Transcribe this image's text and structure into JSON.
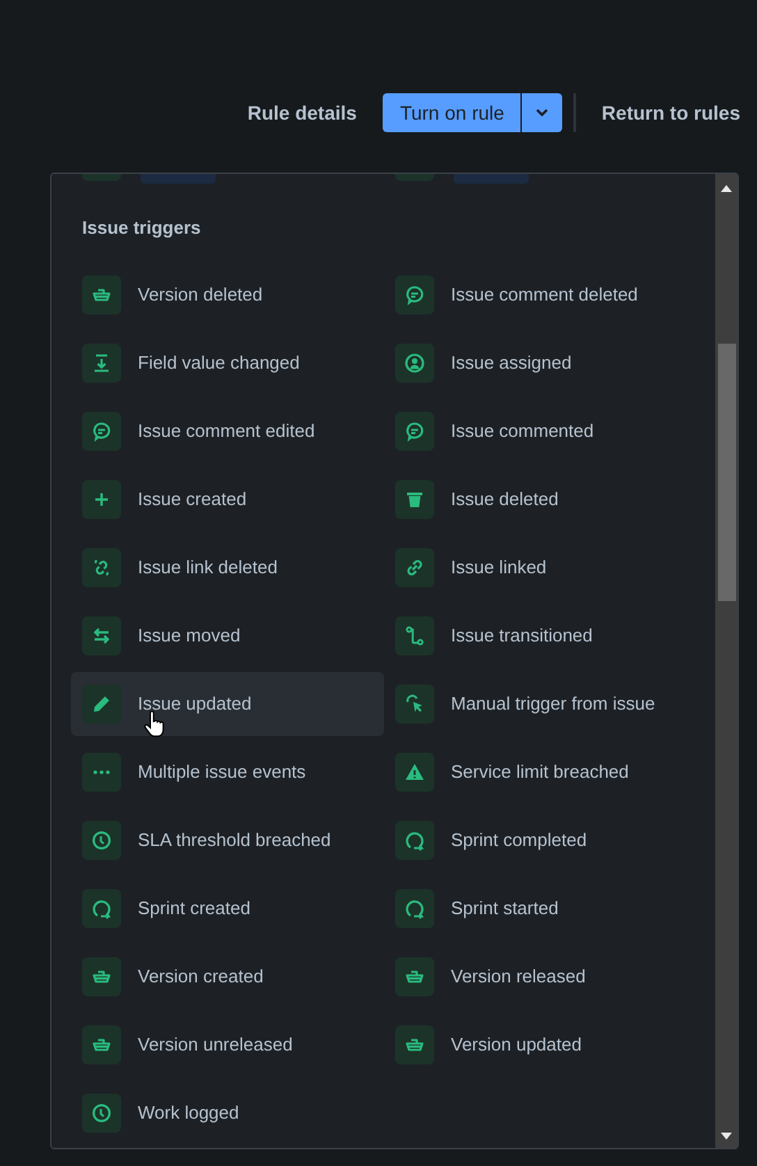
{
  "header": {
    "links": [
      "Rule details",
      "Return to rules"
    ],
    "primary_button": "Turn on rule"
  },
  "section_title": "Issue triggers",
  "triggers": [
    {
      "label": "Version deleted",
      "kind": "ship",
      "hovered": false
    },
    {
      "label": "Issue comment deleted",
      "kind": "comment",
      "hovered": false
    },
    {
      "label": "Field value changed",
      "kind": "download",
      "hovered": false
    },
    {
      "label": "Issue assigned",
      "kind": "person",
      "hovered": false
    },
    {
      "label": "Issue comment edited",
      "kind": "comment",
      "hovered": false
    },
    {
      "label": "Issue commented",
      "kind": "comment",
      "hovered": false
    },
    {
      "label": "Issue created",
      "kind": "plus",
      "hovered": false
    },
    {
      "label": "Issue deleted",
      "kind": "trash",
      "hovered": false
    },
    {
      "label": "Issue link deleted",
      "kind": "brokenlink",
      "hovered": false
    },
    {
      "label": "Issue linked",
      "kind": "link",
      "hovered": false
    },
    {
      "label": "Issue moved",
      "kind": "swap",
      "hovered": false
    },
    {
      "label": "Issue transitioned",
      "kind": "transition",
      "hovered": false
    },
    {
      "label": "Issue updated",
      "kind": "pencil",
      "hovered": true
    },
    {
      "label": "Manual trigger from issue",
      "kind": "pointer",
      "hovered": false
    },
    {
      "label": "Multiple issue events",
      "kind": "dots",
      "hovered": false
    },
    {
      "label": "Service limit breached",
      "kind": "warning",
      "hovered": false
    },
    {
      "label": "SLA threshold breached",
      "kind": "clock",
      "hovered": false
    },
    {
      "label": "Sprint completed",
      "kind": "cycle",
      "hovered": false
    },
    {
      "label": "Sprint created",
      "kind": "cycle",
      "hovered": false
    },
    {
      "label": "Sprint started",
      "kind": "cycle",
      "hovered": false
    },
    {
      "label": "Version created",
      "kind": "ship",
      "hovered": false
    },
    {
      "label": "Version released",
      "kind": "ship",
      "hovered": false
    },
    {
      "label": "Version unreleased",
      "kind": "ship",
      "hovered": false
    },
    {
      "label": "Version updated",
      "kind": "ship",
      "hovered": false
    },
    {
      "label": "Work logged",
      "kind": "clock",
      "hovered": false
    }
  ]
}
